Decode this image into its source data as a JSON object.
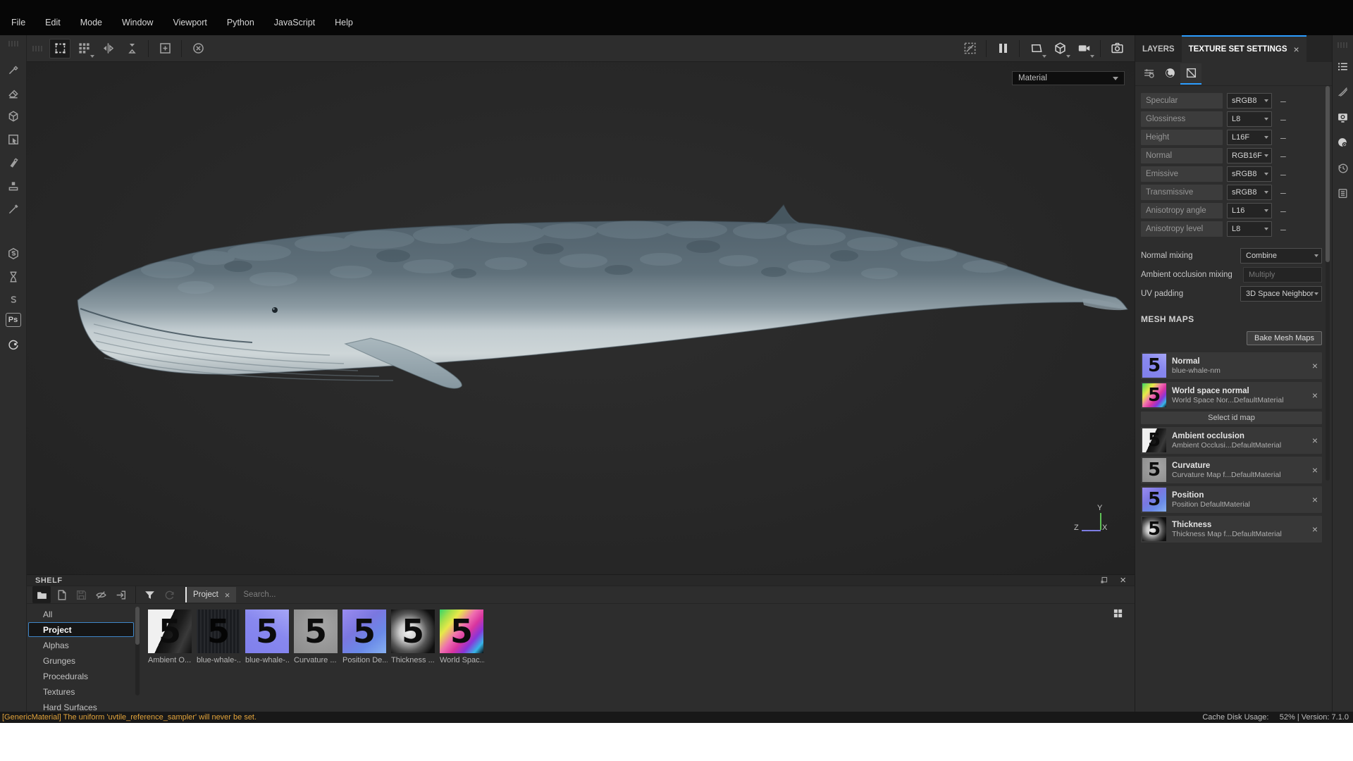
{
  "colors": {
    "accent": "#2b9dff",
    "warning": "#e2a33b",
    "selection": "#3f87c9"
  },
  "menubar": {
    "items": [
      "File",
      "Edit",
      "Mode",
      "Window",
      "Viewport",
      "Python",
      "JavaScript",
      "Help"
    ]
  },
  "viewport": {
    "material_dropdown": "Material",
    "axis": {
      "x": "X",
      "y": "Y",
      "z": "Z"
    }
  },
  "right_panel": {
    "tabs": [
      "LAYERS",
      "TEXTURE SET SETTINGS"
    ],
    "channels": [
      {
        "name": "Specular",
        "format": "sRGB8"
      },
      {
        "name": "Glossiness",
        "format": "L8"
      },
      {
        "name": "Height",
        "format": "L16F"
      },
      {
        "name": "Normal",
        "format": "RGB16F"
      },
      {
        "name": "Emissive",
        "format": "sRGB8"
      },
      {
        "name": "Transmissive",
        "format": "sRGB8"
      },
      {
        "name": "Anisotropy angle",
        "format": "L16"
      },
      {
        "name": "Anisotropy level",
        "format": "L8"
      }
    ],
    "normal_mixing_label": "Normal mixing",
    "normal_mixing_value": "Combine",
    "ao_mixing_label": "Ambient occlusion mixing",
    "ao_mixing_value": "Multiply",
    "uv_padding_label": "UV padding",
    "uv_padding_value": "3D Space Neighbor",
    "mesh_maps_title": "MESH MAPS",
    "bake_button": "Bake Mesh Maps",
    "select_id_button": "Select id map",
    "thumb_glyph": "5",
    "maps": [
      {
        "name": "Normal",
        "source": "blue-whale-nm"
      },
      {
        "name": "World space normal",
        "source": "World Space Nor...DefaultMaterial"
      },
      {
        "name": "Ambient occlusion",
        "source": "Ambient Occlusi...DefaultMaterial"
      },
      {
        "name": "Curvature",
        "source": "Curvature Map f...DefaultMaterial"
      },
      {
        "name": "Position",
        "source": "Position DefaultMaterial"
      },
      {
        "name": "Thickness",
        "source": "Thickness Map f...DefaultMaterial"
      }
    ]
  },
  "shelf": {
    "title": "SHELF",
    "filter_tag": "Project",
    "search_placeholder": "Search...",
    "categories": [
      "All",
      "Project",
      "Alphas",
      "Grunges",
      "Procedurals",
      "Textures",
      "Hard Surfaces"
    ],
    "items": [
      {
        "label": "Ambient O..."
      },
      {
        "label": "blue-whale-..."
      },
      {
        "label": "blue-whale-..."
      },
      {
        "label": "Curvature ..."
      },
      {
        "label": "Position De..."
      },
      {
        "label": "Thickness ..."
      },
      {
        "label": "World Spac..."
      }
    ]
  },
  "statusbar": {
    "warning": "[GenericMaterial] The uniform 'uvtile_reference_sampler' will never be set.",
    "right": "Cache Disk Usage:     52% | Version: 7.1.0"
  }
}
